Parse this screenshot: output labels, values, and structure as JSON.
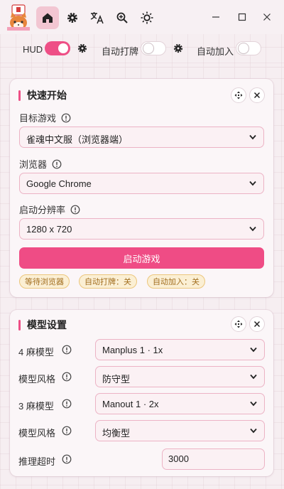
{
  "toolbar": {
    "icons": [
      "home-icon",
      "gear-icon",
      "translate-icon",
      "zoom-icon",
      "theme-sun-icon"
    ],
    "active": "home-icon"
  },
  "window_controls": [
    "minimize",
    "maximize",
    "close"
  ],
  "toggles": {
    "hud": {
      "label": "HUD",
      "on": true
    },
    "auto_play": {
      "label": "自动打牌",
      "on": false
    },
    "auto_join": {
      "label": "自动加入",
      "on": false
    }
  },
  "quick_start": {
    "title": "快速开始",
    "game_label": "目标游戏",
    "game_value": "雀魂中文服（浏览器端）",
    "browser_label": "浏览器",
    "browser_value": "Google Chrome",
    "resolution_label": "启动分辨率",
    "resolution_value": "1280 x 720",
    "start_button": "启动游戏",
    "badges": [
      "等待浏览器",
      "自动打牌：关",
      "自动加入：关"
    ]
  },
  "model_settings": {
    "title": "模型设置",
    "rows": [
      {
        "label": "4 麻模型",
        "value": "Manplus 1 · 1x"
      },
      {
        "label": "模型风格",
        "value": "防守型"
      },
      {
        "label": "3 麻模型",
        "value": "Manout 1 · 2x"
      },
      {
        "label": "模型风格",
        "value": "均衡型"
      }
    ],
    "timeout_label": "推理超时",
    "timeout_value": "3000"
  },
  "colors": {
    "accent": "#ee4f86",
    "badge_bg": "#fbefd4",
    "badge_text": "#a26e1f"
  }
}
